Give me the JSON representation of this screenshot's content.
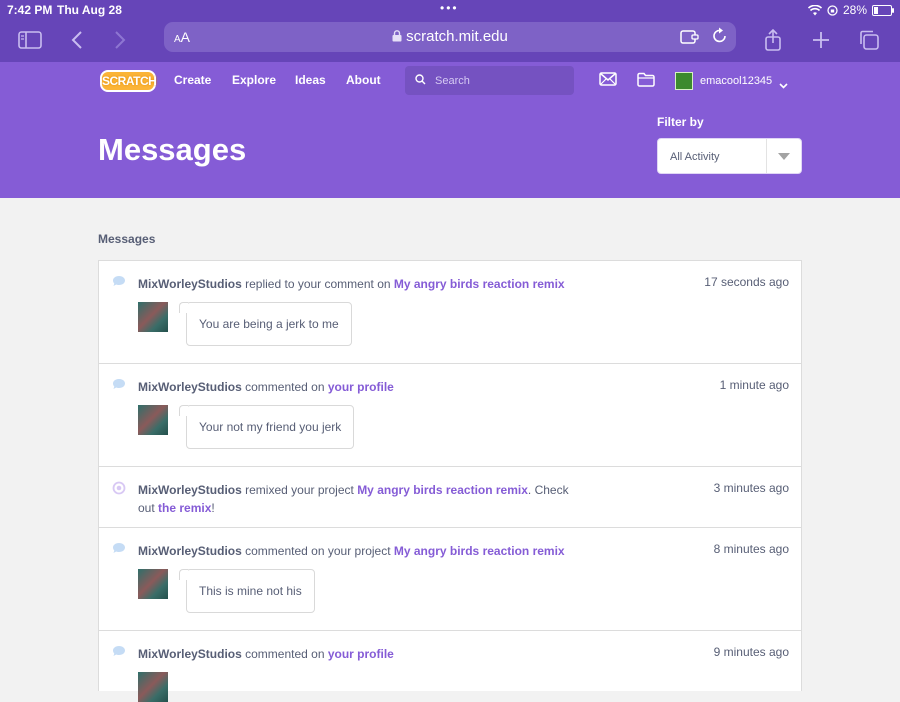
{
  "status_bar": {
    "time": "7:42 PM",
    "date": "Thu Aug 28",
    "battery": "28%"
  },
  "browser": {
    "text_size": "AA",
    "url": "scratch.mit.edu"
  },
  "nav": {
    "logo_text": "SCRATCH",
    "links": [
      "Create",
      "Explore",
      "Ideas",
      "About"
    ],
    "search_placeholder": "Search",
    "username": "emacool12345"
  },
  "header": {
    "title": "Messages",
    "filter_label": "Filter by",
    "filter_value": "All Activity"
  },
  "content": {
    "section_title": "Messages",
    "messages": [
      {
        "type": "comment",
        "user": "MixWorleyStudios",
        "action": " replied to your comment on ",
        "target": "My angry birds reaction remix",
        "suffix": "",
        "time": "17 seconds ago",
        "comment": "You are being a jerk to me"
      },
      {
        "type": "comment",
        "user": "MixWorleyStudios",
        "action": " commented on ",
        "target": "your profile",
        "suffix": "",
        "time": "1 minute ago",
        "comment": "Your not my friend you jerk"
      },
      {
        "type": "remix",
        "user": "MixWorleyStudios",
        "action": " remixed your project ",
        "target": "My angry birds reaction remix",
        "suffix": ". Check out ",
        "link2": "the remix",
        "suffix2": "!",
        "time": "3 minutes ago"
      },
      {
        "type": "comment",
        "user": "MixWorleyStudios",
        "action": " commented on your project ",
        "target": "My angry birds reaction remix",
        "suffix": "",
        "time": "8 minutes ago",
        "comment": "This is mine not his"
      },
      {
        "type": "comment",
        "user": "MixWorleyStudios",
        "action": " commented on ",
        "target": "your profile",
        "suffix": "",
        "time": "9 minutes ago"
      }
    ]
  },
  "colors": {
    "brand_purple": "#855cd6",
    "safari_purple": "#6645b8",
    "link_purple": "#855cd6",
    "text_gray": "#575e75",
    "logo_orange": "#fbb437"
  }
}
